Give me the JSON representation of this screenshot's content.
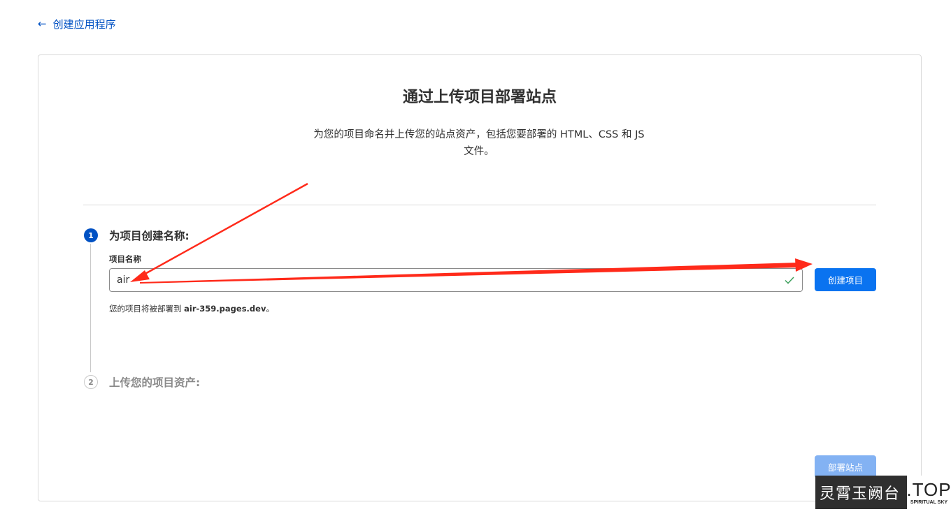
{
  "header": {
    "back_label": "创建应用程序"
  },
  "card": {
    "title": "通过上传项目部署站点",
    "description_line1": "为您的项目命名并上传您的站点资产，包括您要部署的 HTML、CSS 和 JS",
    "description_line2": "文件。"
  },
  "step1": {
    "number": "1",
    "title": "为项目创建名称:",
    "field_label": "项目名称",
    "input_value": "air",
    "create_button": "创建项目",
    "hint_prefix": "您的项目将被部署到 ",
    "hint_domain": "air-359.pages.dev",
    "hint_suffix": "。"
  },
  "step2": {
    "number": "2",
    "title": "上传您的项目资产:"
  },
  "footer": {
    "deploy_button": "部署站点"
  },
  "watermark": {
    "cn": "灵霄玉阙台",
    "top": ".TOP",
    "sub": "SPIRITUAL SKY"
  },
  "colors": {
    "accent": "#0051c3",
    "primary_button": "#0a73f0",
    "disabled_button": "#83b2f3",
    "annotation": "#ff2a1a",
    "valid": "#3ea05d"
  }
}
